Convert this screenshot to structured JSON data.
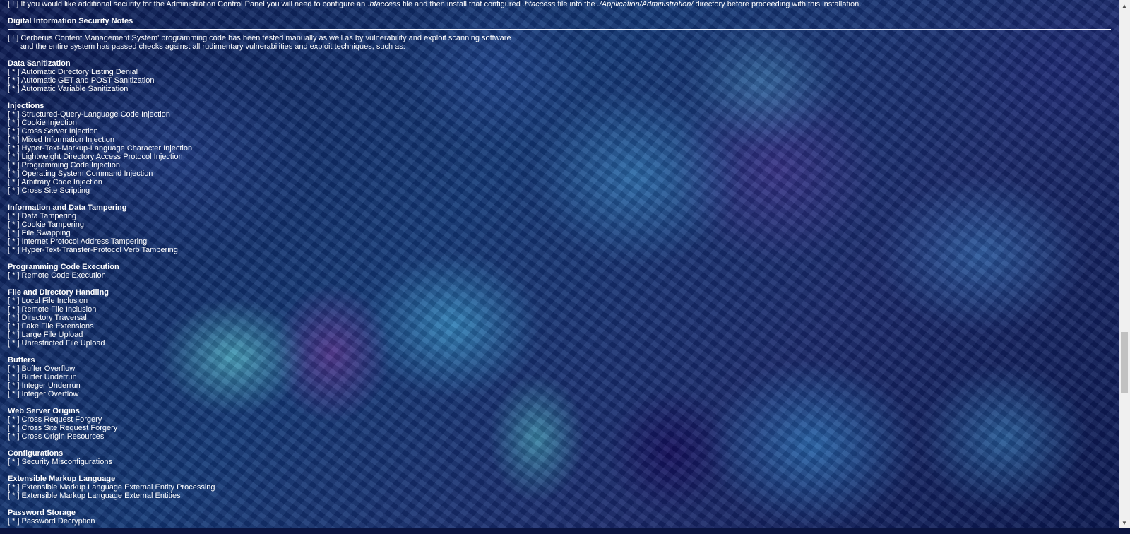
{
  "top_note": {
    "prefix": "[ ! ] If you would like additional security for the Administration Control Panel you will need to configure an ",
    "file1": ".htaccess",
    "mid": " file and then install that configured ",
    "file2": ".htaccess",
    "mid2": " file into the ",
    "path": "./Application/Administration/",
    "suffix": " directory before proceeding with this installation."
  },
  "security_notes": {
    "title": "Digital Information Security Notes",
    "intro_line1": "[ ! ] Cerberus Content Management System' programming code has been tested manually as well as by vulnerability and exploit scanning software",
    "intro_line2": "and the entire system has passed checks against all rudimentary vulnerabilities and exploit techniques, such as:"
  },
  "sections": [
    {
      "title": "Data Sanitization",
      "items": [
        "[ * ] Automatic Directory Listing Denial",
        "[ * ] Automatic GET and POST Sanitization",
        "[ * ] Automatic Variable Sanitization"
      ]
    },
    {
      "title": "Injections",
      "items": [
        "[ * ] Structured-Query-Language Code Injection",
        "[ * ] Cookie Injection",
        "[ * ] Cross Server Injection",
        "[ * ] Mixed Information Injection",
        "[ * ] Hyper-Text-Markup-Language Character Injection",
        "[ * ] Lightweight Directory Access Protocol Injection",
        "[ * ] Programming Code Injection",
        "[ * ] Operating System Command Injection",
        "[ * ] Arbitrary Code Injection",
        "[ * ] Cross Site Scripting"
      ]
    },
    {
      "title": "Information and Data Tampering",
      "items": [
        "[ * ] Data Tampering",
        "[ * ] Cookie Tampering",
        "[ * ] File Swapping",
        "[ * ] Internet Protocol Address Tampering",
        "[ * ] Hyper-Text-Transfer-Protocol Verb Tampering"
      ]
    },
    {
      "title": "Programming Code Execution",
      "items": [
        "[ * ] Remote Code Execution"
      ]
    },
    {
      "title": "File and Directory Handling",
      "items": [
        "[ * ] Local File Inclusion",
        "[ * ] Remote File Inclusion",
        "[ * ] Directory Traversal",
        "[ * ] Fake File Extensions",
        "[ * ] Large File Upload",
        "[ * ] Unrestricted File Upload"
      ]
    },
    {
      "title": "Buffers",
      "items": [
        "[ * ] Buffer Overflow",
        "[ * ] Buffer Underrun",
        "[ * ] Integer Underrun",
        "[ * ] Integer Overflow"
      ]
    },
    {
      "title": "Web Server Origins",
      "items": [
        "[ * ] Cross Request Forgery",
        "[ * ] Cross Site Request Forgery",
        "[ * ] Cross Origin Resources"
      ]
    },
    {
      "title": "Configurations",
      "items": [
        "[ * ] Security Misconfigurations"
      ]
    },
    {
      "title": "Extensible Markup Language",
      "items": [
        "[ * ] Extensible Markup Language External Entity Processing",
        "[ * ] Extensible Markup Language External Entities"
      ]
    },
    {
      "title": "Password Storage",
      "items": [
        "[ * ] Password Decryption"
      ]
    }
  ],
  "scrollbar": {
    "position_fraction": 0.72,
    "visible_fraction": 0.12
  }
}
